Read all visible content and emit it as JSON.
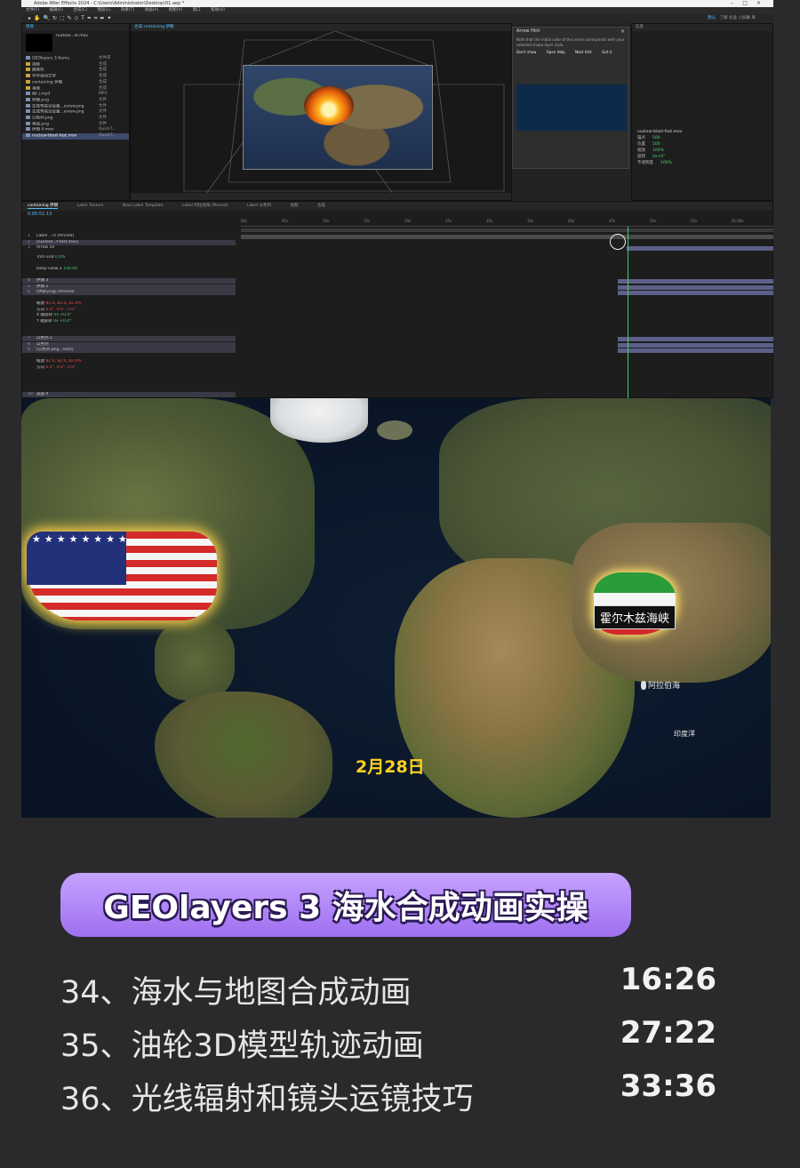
{
  "app": {
    "window_title": "Adobe After Effects 2024 - C:\\Users\\Administrator\\Desktop\\01.aep *",
    "menu": [
      "文件(F)",
      "编辑(E)",
      "合成(C)",
      "图层(L)",
      "效果(T)",
      "动画(A)",
      "视图(V)",
      "窗口",
      "帮助(H)"
    ],
    "workspace": [
      "默认",
      "了解",
      "标准",
      "小屏幕",
      "库"
    ],
    "project_tab": "项目",
    "project_selected": "nuclear...st.mov",
    "project_items": [
      {
        "name": "GEOlayers 3 Items",
        "type": "文件夹"
      },
      {
        "name": "视频",
        "type": "合成"
      },
      {
        "name": "摄像机",
        "type": "合成"
      },
      {
        "name": "中华诗词文字",
        "type": "合成"
      },
      {
        "name": "containing 伊朗",
        "type": "合成"
      },
      {
        "name": "海域",
        "type": "合成"
      },
      {
        "name": "阀门.mp3",
        "type": "MP3"
      },
      {
        "name": "伊朗.png",
        "type": "文件"
      },
      {
        "name": "生成等高全设置...eview.png",
        "type": "文件"
      },
      {
        "name": "生成等高全设置...eview.png",
        "type": "文件"
      },
      {
        "name": "以色列.png",
        "type": "文件"
      },
      {
        "name": "美国.png",
        "type": "文件"
      },
      {
        "name": "伊朗 4.mov",
        "type": "QuickT..."
      },
      {
        "name": "nuclear-blast-fast.mov",
        "type": "QuickT..."
      }
    ],
    "comp_tab": "合成 containing 伊朗",
    "dialog": {
      "title": "Arrow Hint",
      "text": "Note that the initial color of the arrow corresponds with your selected shape layer style.",
      "buttons": [
        "Open Help",
        "Next Hint",
        "Got it"
      ],
      "checkbox": "Don't show"
    },
    "right_panel": {
      "title": "信息",
      "props": [
        {
          "label": "锚点",
          "value": "500"
        },
        {
          "label": "位置",
          "value": "500"
        },
        {
          "label": "缩放",
          "value": "100%"
        },
        {
          "label": "旋转",
          "value": "0x+0°"
        },
        {
          "label": "不透明度",
          "value": "100%"
        }
      ],
      "file": "nuclear-blast-fast.mov"
    },
    "timeline": {
      "tabs": [
        "containing 伊朗",
        "Label Texture",
        "New Label Template",
        "Label 阿拉伯海 (Pinned)",
        "Label 以色列",
        "视频",
        "合成"
      ],
      "timecode": "0:00:51:13",
      "ruler": [
        "00s",
        "05s",
        "10s",
        "15s",
        "20s",
        "25s",
        "30s",
        "35s",
        "40s",
        "45s",
        "50s",
        "55s",
        "01:00s"
      ],
      "layers": [
        {
          "num": "1",
          "name": "Label ...rs (Pinned)"
        },
        {
          "num": "2",
          "name": "[nuclear...t-fast.mov]"
        },
        {
          "num": "3",
          "name": "Arrow 10"
        },
        {
          "num": "",
          "name": "Trim End",
          "value": "0.0%"
        },
        {
          "num": "",
          "name": "Deep Glow 2",
          "value": "100.00"
        },
        {
          "num": "4",
          "name": "伊朗 3"
        },
        {
          "num": "5",
          "name": "伊朗 2"
        },
        {
          "num": "6",
          "name": "[伊朗.png] (Pinned)"
        },
        {
          "num": "",
          "name": "缩放",
          "value": "82.0, 82.0, 82.0%"
        },
        {
          "num": "",
          "name": "方向",
          "value": "0.0°, 0.0°, 0.0°"
        },
        {
          "num": "",
          "name": "X 轴旋转",
          "value": "0x +0.0°"
        },
        {
          "num": "",
          "name": "Y 轴旋转",
          "value": "0x +0.0°"
        },
        {
          "num": "7",
          "name": "以色列 2"
        },
        {
          "num": "8",
          "name": "以色列"
        },
        {
          "num": "9",
          "name": "[以色列.png...ned)]"
        },
        {
          "num": "",
          "name": "缩放",
          "value": "82.0, 82.0, 82.0%"
        },
        {
          "num": "",
          "name": "方向",
          "value": "0.0°, 0.0°, 0.0°"
        },
        {
          "num": "10",
          "name": "美国 4"
        }
      ]
    }
  },
  "video": {
    "hormuz_label": "霍尔木兹海峡",
    "arabian_sea": "阿拉伯海",
    "indian_ocean": "印度洋",
    "date": "2月28日",
    "colors": {
      "date": "#ffd21f",
      "glow": "#ffd24d"
    }
  },
  "course": {
    "title": "GEOlayers 3 海水合成动画实操",
    "lessons": [
      {
        "title": "34、海水与地图合成动画",
        "time": "16:26"
      },
      {
        "title": "35、油轮3D模型轨迹动画",
        "time": "27:22"
      },
      {
        "title": "36、光线辐射和镜头运镜技巧",
        "time": "33:36"
      }
    ]
  }
}
